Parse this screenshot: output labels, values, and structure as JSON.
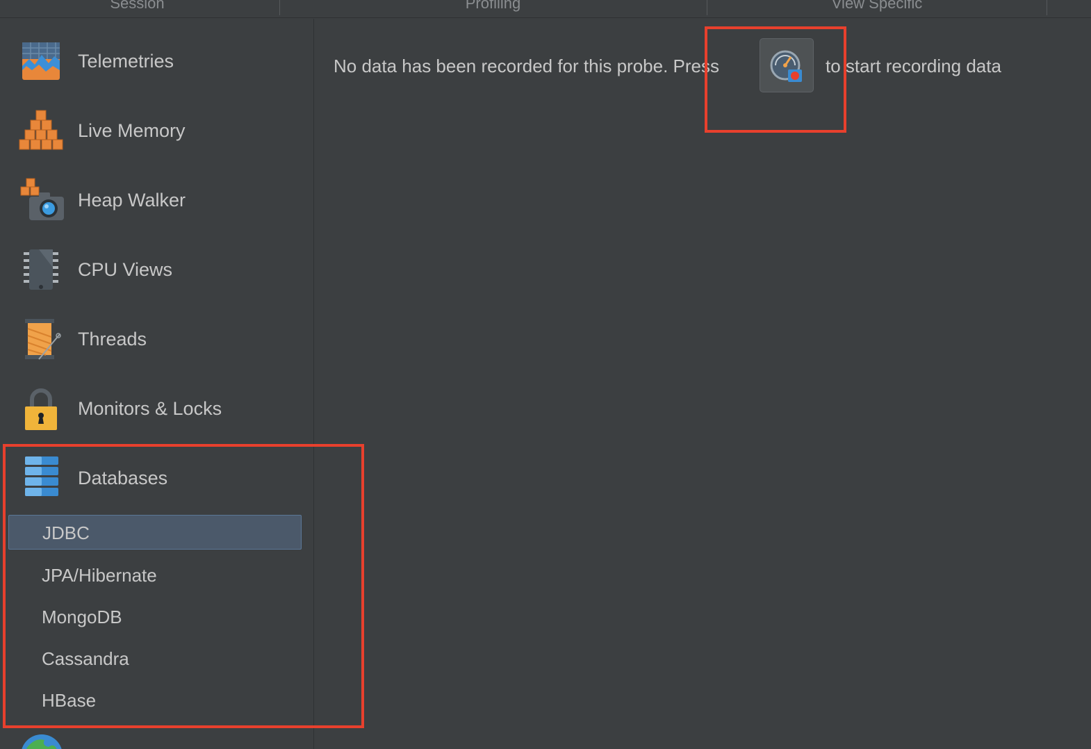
{
  "toolbar_groups": [
    {
      "label": "Session"
    },
    {
      "label": "Profiling"
    },
    {
      "label": "View Specific"
    }
  ],
  "sidebar": {
    "items": [
      {
        "label": "Telemetries",
        "icon": "telemetries-chart-icon"
      },
      {
        "label": "Live Memory",
        "icon": "live-memory-cubes-icon"
      },
      {
        "label": "Heap Walker",
        "icon": "heap-walker-camera-icon"
      },
      {
        "label": "CPU Views",
        "icon": "cpu-chip-icon"
      },
      {
        "label": "Threads",
        "icon": "threads-spool-icon"
      },
      {
        "label": "Monitors & Locks",
        "icon": "padlock-icon"
      },
      {
        "label": "Databases",
        "icon": "database-stack-icon"
      }
    ],
    "databases_subitems": [
      {
        "label": "JDBC",
        "selected": true
      },
      {
        "label": "JPA/Hibernate",
        "selected": false
      },
      {
        "label": "MongoDB",
        "selected": false
      },
      {
        "label": "Cassandra",
        "selected": false
      },
      {
        "label": "HBase",
        "selected": false
      }
    ],
    "next_item_icon": "globe-icon"
  },
  "main": {
    "message_prefix": "No data has been recorded for this probe. Press",
    "message_suffix": "to start recording data",
    "record_button_icon": "start-recording-gauge-icon"
  },
  "colors": {
    "background": "#3c3f41",
    "selection": "#4b596a",
    "highlight": "#e8402d",
    "text": "#c8c8c8"
  }
}
